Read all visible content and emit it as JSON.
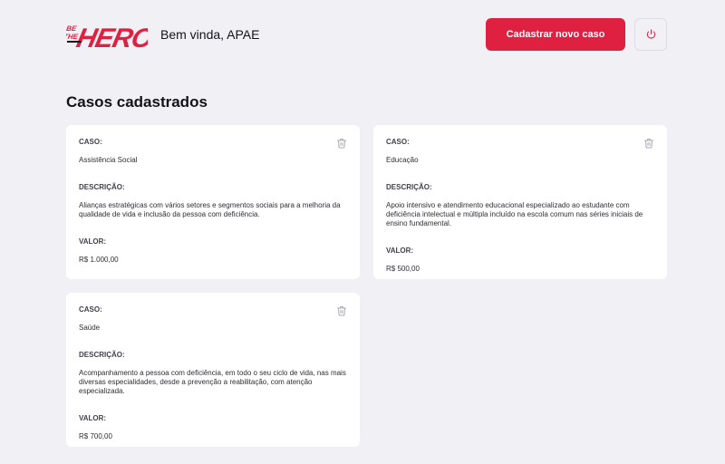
{
  "header": {
    "logo_text": "BE THE HERO",
    "welcome": "Bem vinda, APAE",
    "new_case_label": "Cadastrar novo caso",
    "logout_icon": "power-icon"
  },
  "page_title": "Casos cadastrados",
  "labels": {
    "case": "CASO:",
    "description": "DESCRIÇÃO:",
    "value": "VALOR:"
  },
  "cases": [
    {
      "case": "Assistência Social",
      "description": "Alianças estratégicas com vários setores e segmentos sociais para a melhoria da qualidade de vida e inclusão da pessoa com deficiência.",
      "value": "R$ 1.000,00"
    },
    {
      "case": "Educação",
      "description": "Apoio intensivo e atendimento educacional especializado ao estudante com deficiência intelectual e múltipla incluído na escola comum nas séries iniciais de ensino fundamental.",
      "value": "R$ 500,00"
    },
    {
      "case": "Saúde",
      "description": "Acompanhamento a pessoa com deficiência, em todo o seu ciclo de vida, nas mais diversas especialidades, desde a prevenção a reabilitação, com atenção especializada.",
      "value": "R$ 700,00"
    }
  ],
  "colors": {
    "brand": "#e02041",
    "background": "#f0f0f5",
    "card": "#ffffff"
  }
}
